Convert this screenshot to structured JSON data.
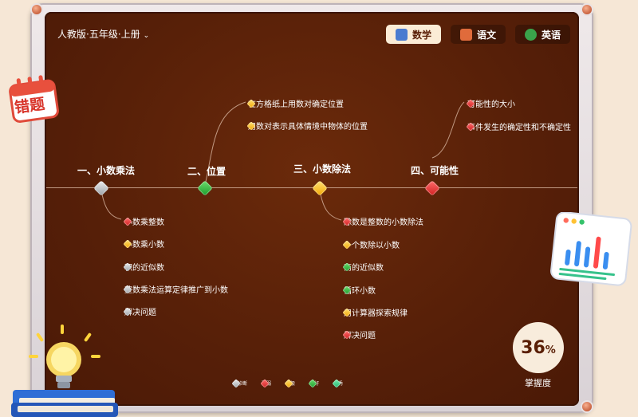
{
  "grade_selector": {
    "label": "人教版·五年级·上册"
  },
  "tabs": [
    {
      "label": "数学",
      "active": true,
      "color": "#4a7bd0"
    },
    {
      "label": "语文",
      "active": false,
      "color": "#e06b3b"
    },
    {
      "label": "英语",
      "active": false,
      "color": "#3aa34a"
    }
  ],
  "badge": {
    "label": "错题"
  },
  "sections": [
    {
      "title": "一、小数乘法",
      "gem": "grey",
      "items": [
        {
          "label": "小数乘整数",
          "gem": "red"
        },
        {
          "label": "小数乘小数",
          "gem": "yellow"
        },
        {
          "label": "积的近似数",
          "gem": "grey"
        },
        {
          "label": "整数乘法运算定律推广到小数",
          "gem": "grey"
        },
        {
          "label": "解决问题",
          "gem": "grey"
        }
      ]
    },
    {
      "title": "二、位置",
      "gem": "green",
      "items": [
        {
          "label": "在方格纸上用数对确定位置",
          "gem": "yellow"
        },
        {
          "label": "用数对表示具体情境中物体的位置",
          "gem": "yellow"
        }
      ]
    },
    {
      "title": "三、小数除法",
      "gem": "yellow",
      "items": [
        {
          "label": "除数是整数的小数除法",
          "gem": "red"
        },
        {
          "label": "一个数除以小数",
          "gem": "yellow"
        },
        {
          "label": "商的近似数",
          "gem": "green"
        },
        {
          "label": "循环小数",
          "gem": "green"
        },
        {
          "label": "用计算器探索规律",
          "gem": "yellow"
        },
        {
          "label": "解决问题",
          "gem": "red"
        }
      ]
    },
    {
      "title": "四、可能性",
      "gem": "red",
      "items": [
        {
          "label": "可能性的大小",
          "gem": "red"
        },
        {
          "label": "事件发生的确定性和不确定性",
          "gem": "red"
        }
      ]
    }
  ],
  "legend": [
    {
      "label": "未诊断",
      "gem": "grey"
    },
    {
      "label": "薄弱",
      "gem": "red"
    },
    {
      "label": "一般",
      "gem": "yellow"
    },
    {
      "label": "较好",
      "gem": "green"
    },
    {
      "label": "优秀",
      "gem": "teal"
    }
  ],
  "mastery": {
    "value": "36",
    "unit": "%",
    "label": "掌握度"
  }
}
